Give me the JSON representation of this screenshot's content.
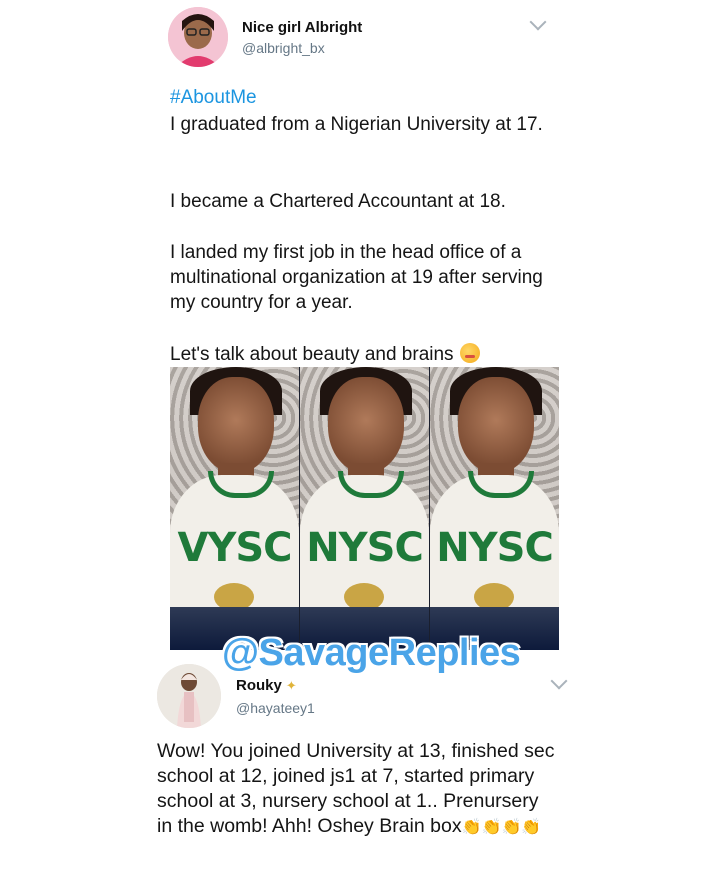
{
  "tweet1": {
    "display_name": "Nice girl Albright",
    "handle": "@albright_bx",
    "hashtag": "#AboutMe",
    "paragraphs": [
      "I graduated from a Nigerian University at 17.",
      "I became a Chartered Accountant at 18.",
      "I landed my first job in the head office of a multinational organization at 19 after serving my country for a year.",
      "Let's talk about beauty and brains"
    ],
    "photo_labels": [
      "VYSC",
      "NYSC",
      "NYSC"
    ]
  },
  "watermark": "@SavageReplies",
  "tweet2": {
    "display_name": "Rouky",
    "handle": "@hayateey1",
    "text": "Wow! You joined University at 13, finished sec school at 12, joined js1 at 7, started primary school at 3, nursery school at 1.. Prenursery in the womb! Ahh! Oshey Brain box",
    "trailing_glyphs": "👏👏👏👏"
  },
  "icons": {
    "caret": "chevron-down-icon",
    "emoji": "smiling-face-icon",
    "verified": "sparkle-icon"
  },
  "colors": {
    "hashtag": "#1b95e0",
    "watermark": "#4aa4e8",
    "nysc_green": "#1f7a3a"
  }
}
